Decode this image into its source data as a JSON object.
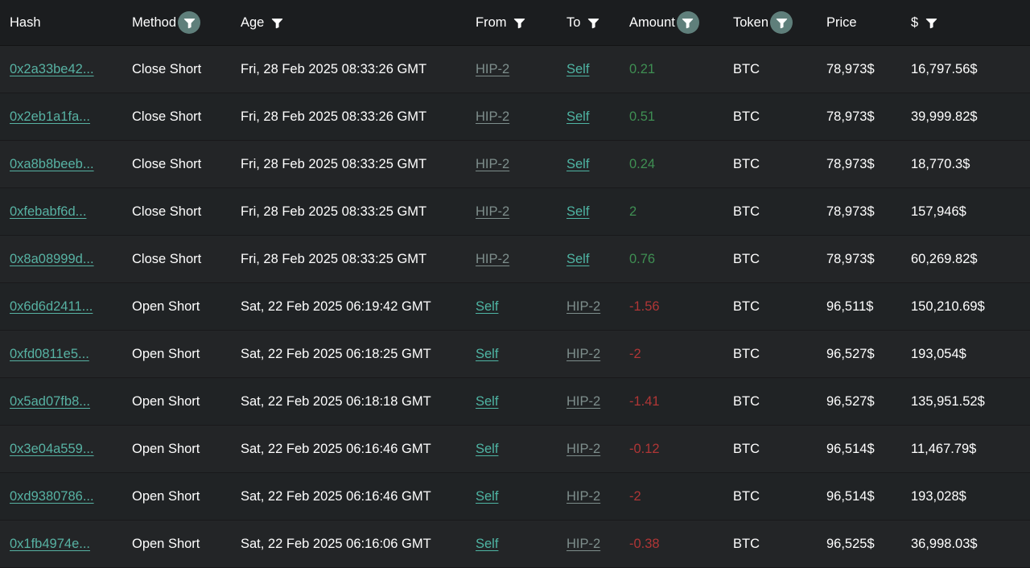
{
  "colors": {
    "page_background": "#1b1d1f",
    "row_background": "#232527",
    "row_background_alt": "#202325",
    "divider": "#19191b",
    "link_teal": "#57b2a3",
    "link_dim": "#7e8e8c",
    "amount_positive": "#3f8f53",
    "amount_negative": "#b03636",
    "filter_active_circle": "#5f7f7b",
    "text": "#ffffff"
  },
  "table": {
    "columns": [
      {
        "key": "hash",
        "label": "Hash",
        "filter": false,
        "filter_active": false
      },
      {
        "key": "method",
        "label": "Method",
        "filter": true,
        "filter_active": true
      },
      {
        "key": "age",
        "label": "Age",
        "filter": true,
        "filter_active": false
      },
      {
        "key": "from",
        "label": "From",
        "filter": true,
        "filter_active": false
      },
      {
        "key": "to",
        "label": "To",
        "filter": true,
        "filter_active": false
      },
      {
        "key": "amount",
        "label": "Amount",
        "filter": true,
        "filter_active": true
      },
      {
        "key": "token",
        "label": "Token",
        "filter": true,
        "filter_active": true
      },
      {
        "key": "price",
        "label": "Price",
        "filter": false,
        "filter_active": false
      },
      {
        "key": "usd",
        "label": "$",
        "filter": true,
        "filter_active": false
      }
    ],
    "filter_icon_name": "filter-funnel-icon",
    "rows": [
      {
        "hash": "0x2a33be42...",
        "method": "Close Short",
        "age": "Fri, 28 Feb 2025 08:33:26 GMT",
        "from": "HIP-2",
        "from_style": "dim",
        "to": "Self",
        "to_style": "bright",
        "amount": "0.21",
        "amount_sign": "positive",
        "token": "BTC",
        "price": "78,973$",
        "usd": "16,797.56$"
      },
      {
        "hash": "0x2eb1a1fa...",
        "method": "Close Short",
        "age": "Fri, 28 Feb 2025 08:33:26 GMT",
        "from": "HIP-2",
        "from_style": "dim",
        "to": "Self",
        "to_style": "bright",
        "amount": "0.51",
        "amount_sign": "positive",
        "token": "BTC",
        "price": "78,973$",
        "usd": "39,999.82$"
      },
      {
        "hash": "0xa8b8beeb...",
        "method": "Close Short",
        "age": "Fri, 28 Feb 2025 08:33:25 GMT",
        "from": "HIP-2",
        "from_style": "dim",
        "to": "Self",
        "to_style": "bright",
        "amount": "0.24",
        "amount_sign": "positive",
        "token": "BTC",
        "price": "78,973$",
        "usd": "18,770.3$"
      },
      {
        "hash": "0xfebabf6d...",
        "method": "Close Short",
        "age": "Fri, 28 Feb 2025 08:33:25 GMT",
        "from": "HIP-2",
        "from_style": "dim",
        "to": "Self",
        "to_style": "bright",
        "amount": "2",
        "amount_sign": "positive",
        "token": "BTC",
        "price": "78,973$",
        "usd": "157,946$"
      },
      {
        "hash": "0x8a08999d...",
        "method": "Close Short",
        "age": "Fri, 28 Feb 2025 08:33:25 GMT",
        "from": "HIP-2",
        "from_style": "dim",
        "to": "Self",
        "to_style": "bright",
        "amount": "0.76",
        "amount_sign": "positive",
        "token": "BTC",
        "price": "78,973$",
        "usd": "60,269.82$"
      },
      {
        "hash": "0x6d6d2411...",
        "method": "Open Short",
        "age": "Sat, 22 Feb 2025 06:19:42 GMT",
        "from": "Self",
        "from_style": "bright",
        "to": "HIP-2",
        "to_style": "dim",
        "amount": "-1.56",
        "amount_sign": "negative",
        "token": "BTC",
        "price": "96,511$",
        "usd": "150,210.69$"
      },
      {
        "hash": "0xfd0811e5...",
        "method": "Open Short",
        "age": "Sat, 22 Feb 2025 06:18:25 GMT",
        "from": "Self",
        "from_style": "bright",
        "to": "HIP-2",
        "to_style": "dim",
        "amount": "-2",
        "amount_sign": "negative",
        "token": "BTC",
        "price": "96,527$",
        "usd": "193,054$"
      },
      {
        "hash": "0x5ad07fb8...",
        "method": "Open Short",
        "age": "Sat, 22 Feb 2025 06:18:18 GMT",
        "from": "Self",
        "from_style": "bright",
        "to": "HIP-2",
        "to_style": "dim",
        "amount": "-1.41",
        "amount_sign": "negative",
        "token": "BTC",
        "price": "96,527$",
        "usd": "135,951.52$"
      },
      {
        "hash": "0x3e04a559...",
        "method": "Open Short",
        "age": "Sat, 22 Feb 2025 06:16:46 GMT",
        "from": "Self",
        "from_style": "bright",
        "to": "HIP-2",
        "to_style": "dim",
        "amount": "-0.12",
        "amount_sign": "negative",
        "token": "BTC",
        "price": "96,514$",
        "usd": "11,467.79$"
      },
      {
        "hash": "0xd9380786...",
        "method": "Open Short",
        "age": "Sat, 22 Feb 2025 06:16:46 GMT",
        "from": "Self",
        "from_style": "bright",
        "to": "HIP-2",
        "to_style": "dim",
        "amount": "-2",
        "amount_sign": "negative",
        "token": "BTC",
        "price": "96,514$",
        "usd": "193,028$"
      },
      {
        "hash": "0x1fb4974e...",
        "method": "Open Short",
        "age": "Sat, 22 Feb 2025 06:16:06 GMT",
        "from": "Self",
        "from_style": "bright",
        "to": "HIP-2",
        "to_style": "dim",
        "amount": "-0.38",
        "amount_sign": "negative",
        "token": "BTC",
        "price": "96,525$",
        "usd": "36,998.03$"
      }
    ]
  }
}
